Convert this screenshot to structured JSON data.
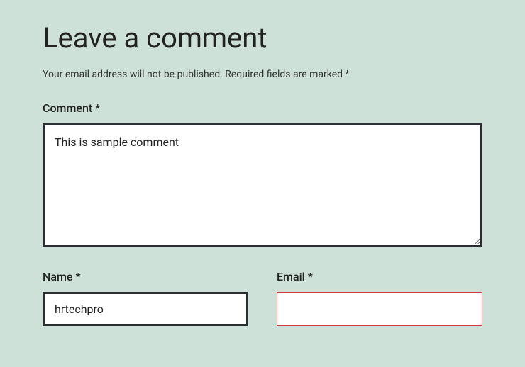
{
  "heading": "Leave a comment",
  "notice": "Your email address will not be published. Required fields are marked *",
  "fields": {
    "comment": {
      "label": "Comment *",
      "value": "This is sample comment"
    },
    "name": {
      "label": "Name *",
      "value": "hrtechpro"
    },
    "email": {
      "label": "Email *",
      "value": ""
    }
  }
}
